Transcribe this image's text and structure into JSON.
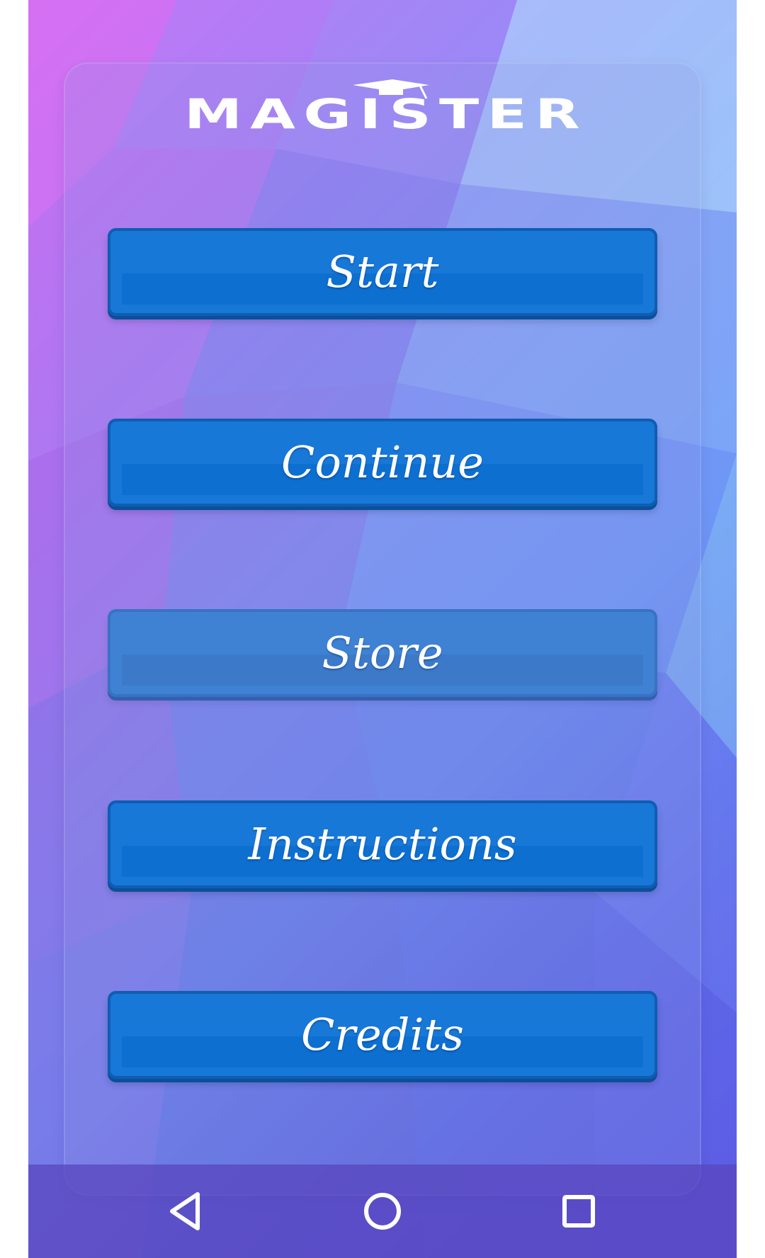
{
  "app": {
    "logo_text": "MAGISTER"
  },
  "menu": {
    "buttons": [
      {
        "label": "Start"
      },
      {
        "label": "Continue"
      },
      {
        "label": "Store"
      },
      {
        "label": "Instructions"
      },
      {
        "label": "Credits"
      }
    ]
  },
  "navigation": {
    "buttons": [
      {
        "icon": "back-triangle-icon"
      },
      {
        "icon": "home-circle-icon"
      },
      {
        "icon": "recent-apps-square-icon"
      }
    ]
  },
  "colors": {
    "button_blue": "#1778d8",
    "button_faded": "#3f82d4",
    "text_white": "#ffffff",
    "nav_purple": "#5a46be"
  }
}
